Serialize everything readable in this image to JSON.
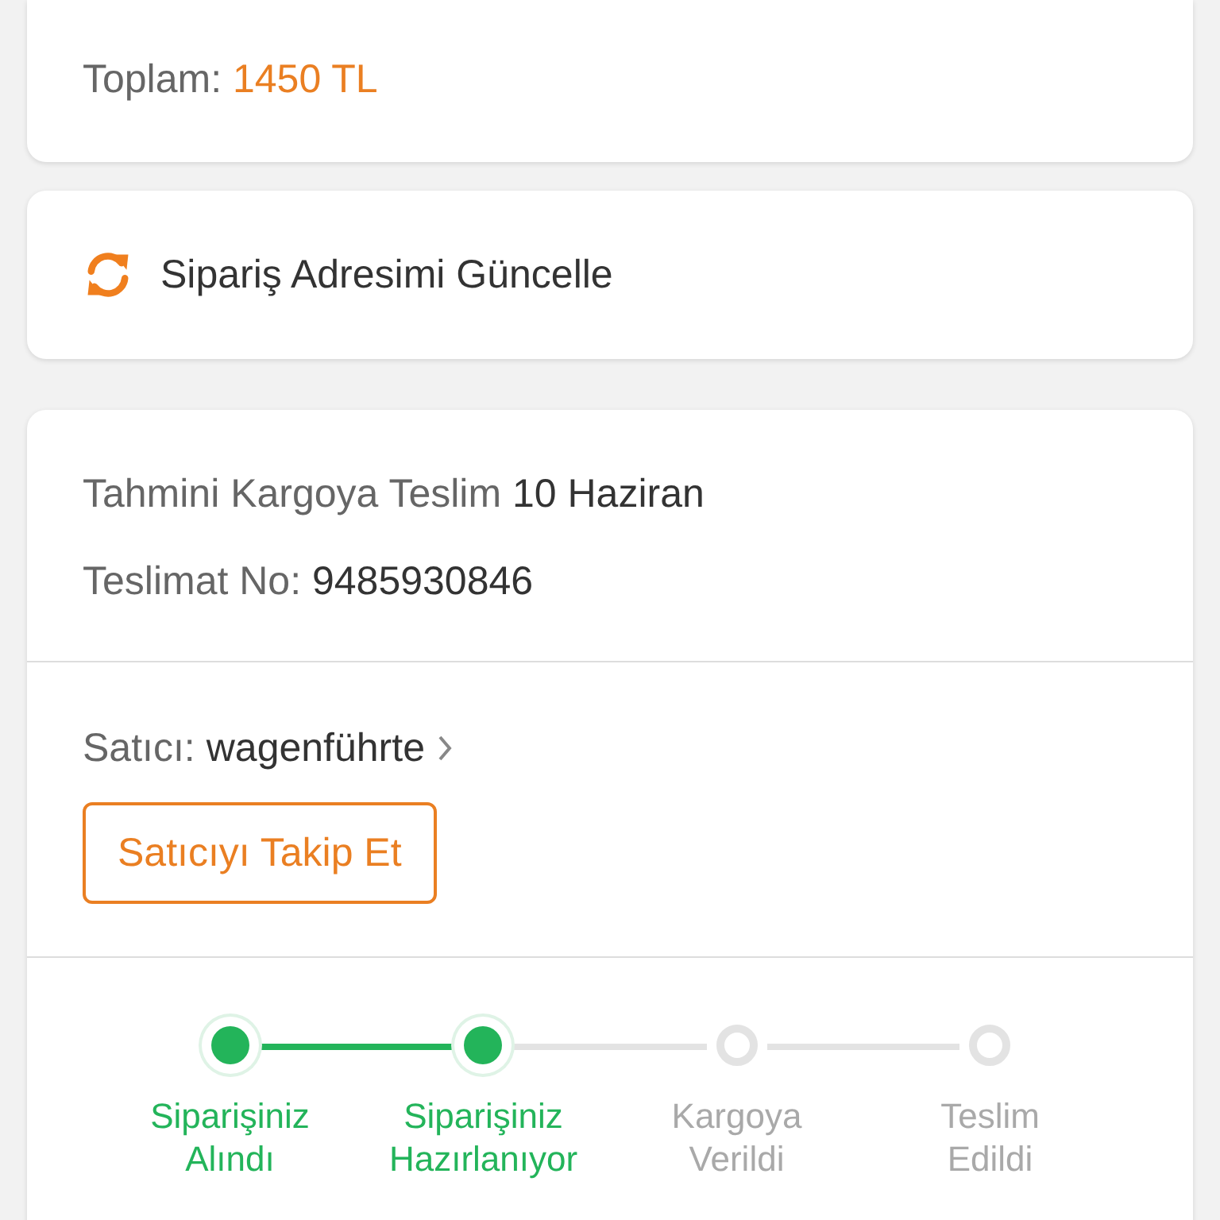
{
  "summary": {
    "total_label": "Toplam:",
    "total_value": "1450 TL"
  },
  "address_action": {
    "label": "Sipariş Adresimi Güncelle"
  },
  "shipment": {
    "estimate_label": "Tahmini Kargoya Teslim",
    "estimate_value": "10 Haziran",
    "delivery_label": "Teslimat No:",
    "delivery_value": "9485930846"
  },
  "seller": {
    "label": "Satıcı:",
    "name": "wagenführte",
    "follow_button": "Satıcıyı Takip Et"
  },
  "steps": [
    {
      "line1": "Siparişiniz",
      "line2": "Alındı",
      "done": true
    },
    {
      "line1": "Siparişiniz",
      "line2": "Hazırlanıyor",
      "done": true
    },
    {
      "line1": "Kargoya",
      "line2": "Verildi",
      "done": false
    },
    {
      "line1": "Teslim",
      "line2": "Edildi",
      "done": false
    }
  ]
}
